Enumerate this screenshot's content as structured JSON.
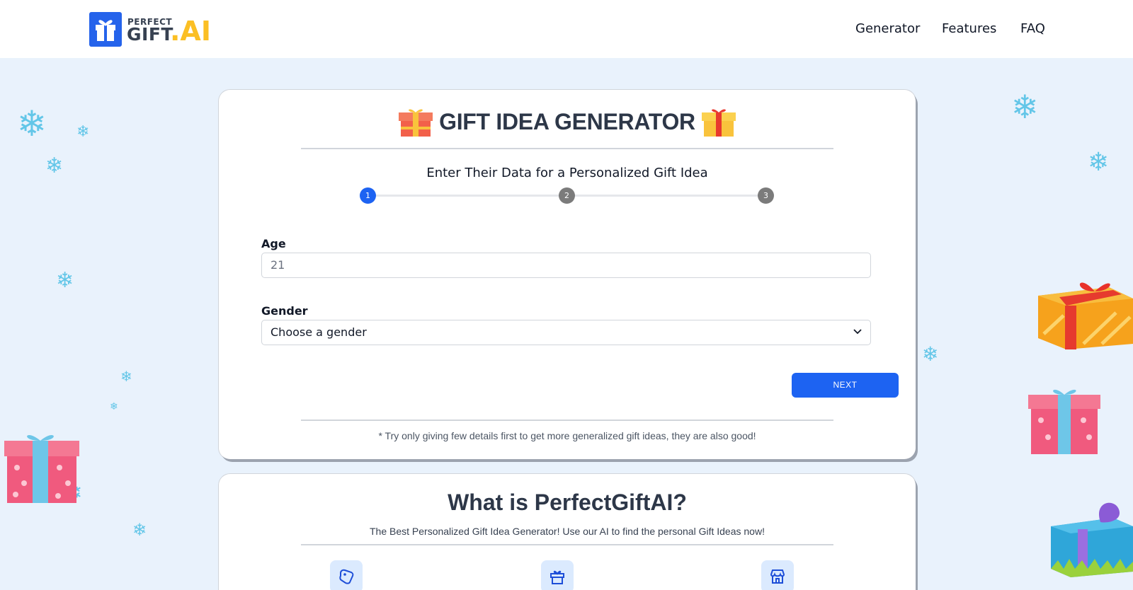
{
  "header": {
    "logo_top": "PERFECT",
    "logo_gift": "GIFT",
    "logo_ai": ".AI",
    "nav": [
      "Generator",
      "Features",
      "FAQ"
    ]
  },
  "generator": {
    "title": "GIFT IDEA GENERATOR",
    "subtitle": "Enter Their Data for a Personalized Gift Idea",
    "steps": [
      "1",
      "2",
      "3"
    ],
    "current_step": 1,
    "age_label": "Age",
    "age_value": "21",
    "gender_label": "Gender",
    "gender_value": "Choose a gender",
    "next_label": "NEXT",
    "footnote": "* Try only giving few details first to get more generalized gift ideas, they are also good!"
  },
  "about": {
    "title": "What is PerfectGiftAI?",
    "lead": "The Best Personalized Gift Idea Generator! Use our AI to find the personal Gift Ideas now!",
    "feature_icons": [
      "tag-icon",
      "gift-box-icon",
      "store-icon"
    ]
  },
  "colors": {
    "accent": "#1d63f2",
    "logo_yellow": "#fbbf24",
    "step_active": "#1d63f2",
    "step_inactive": "#7b7b7b",
    "background": "#e9f2fc"
  }
}
